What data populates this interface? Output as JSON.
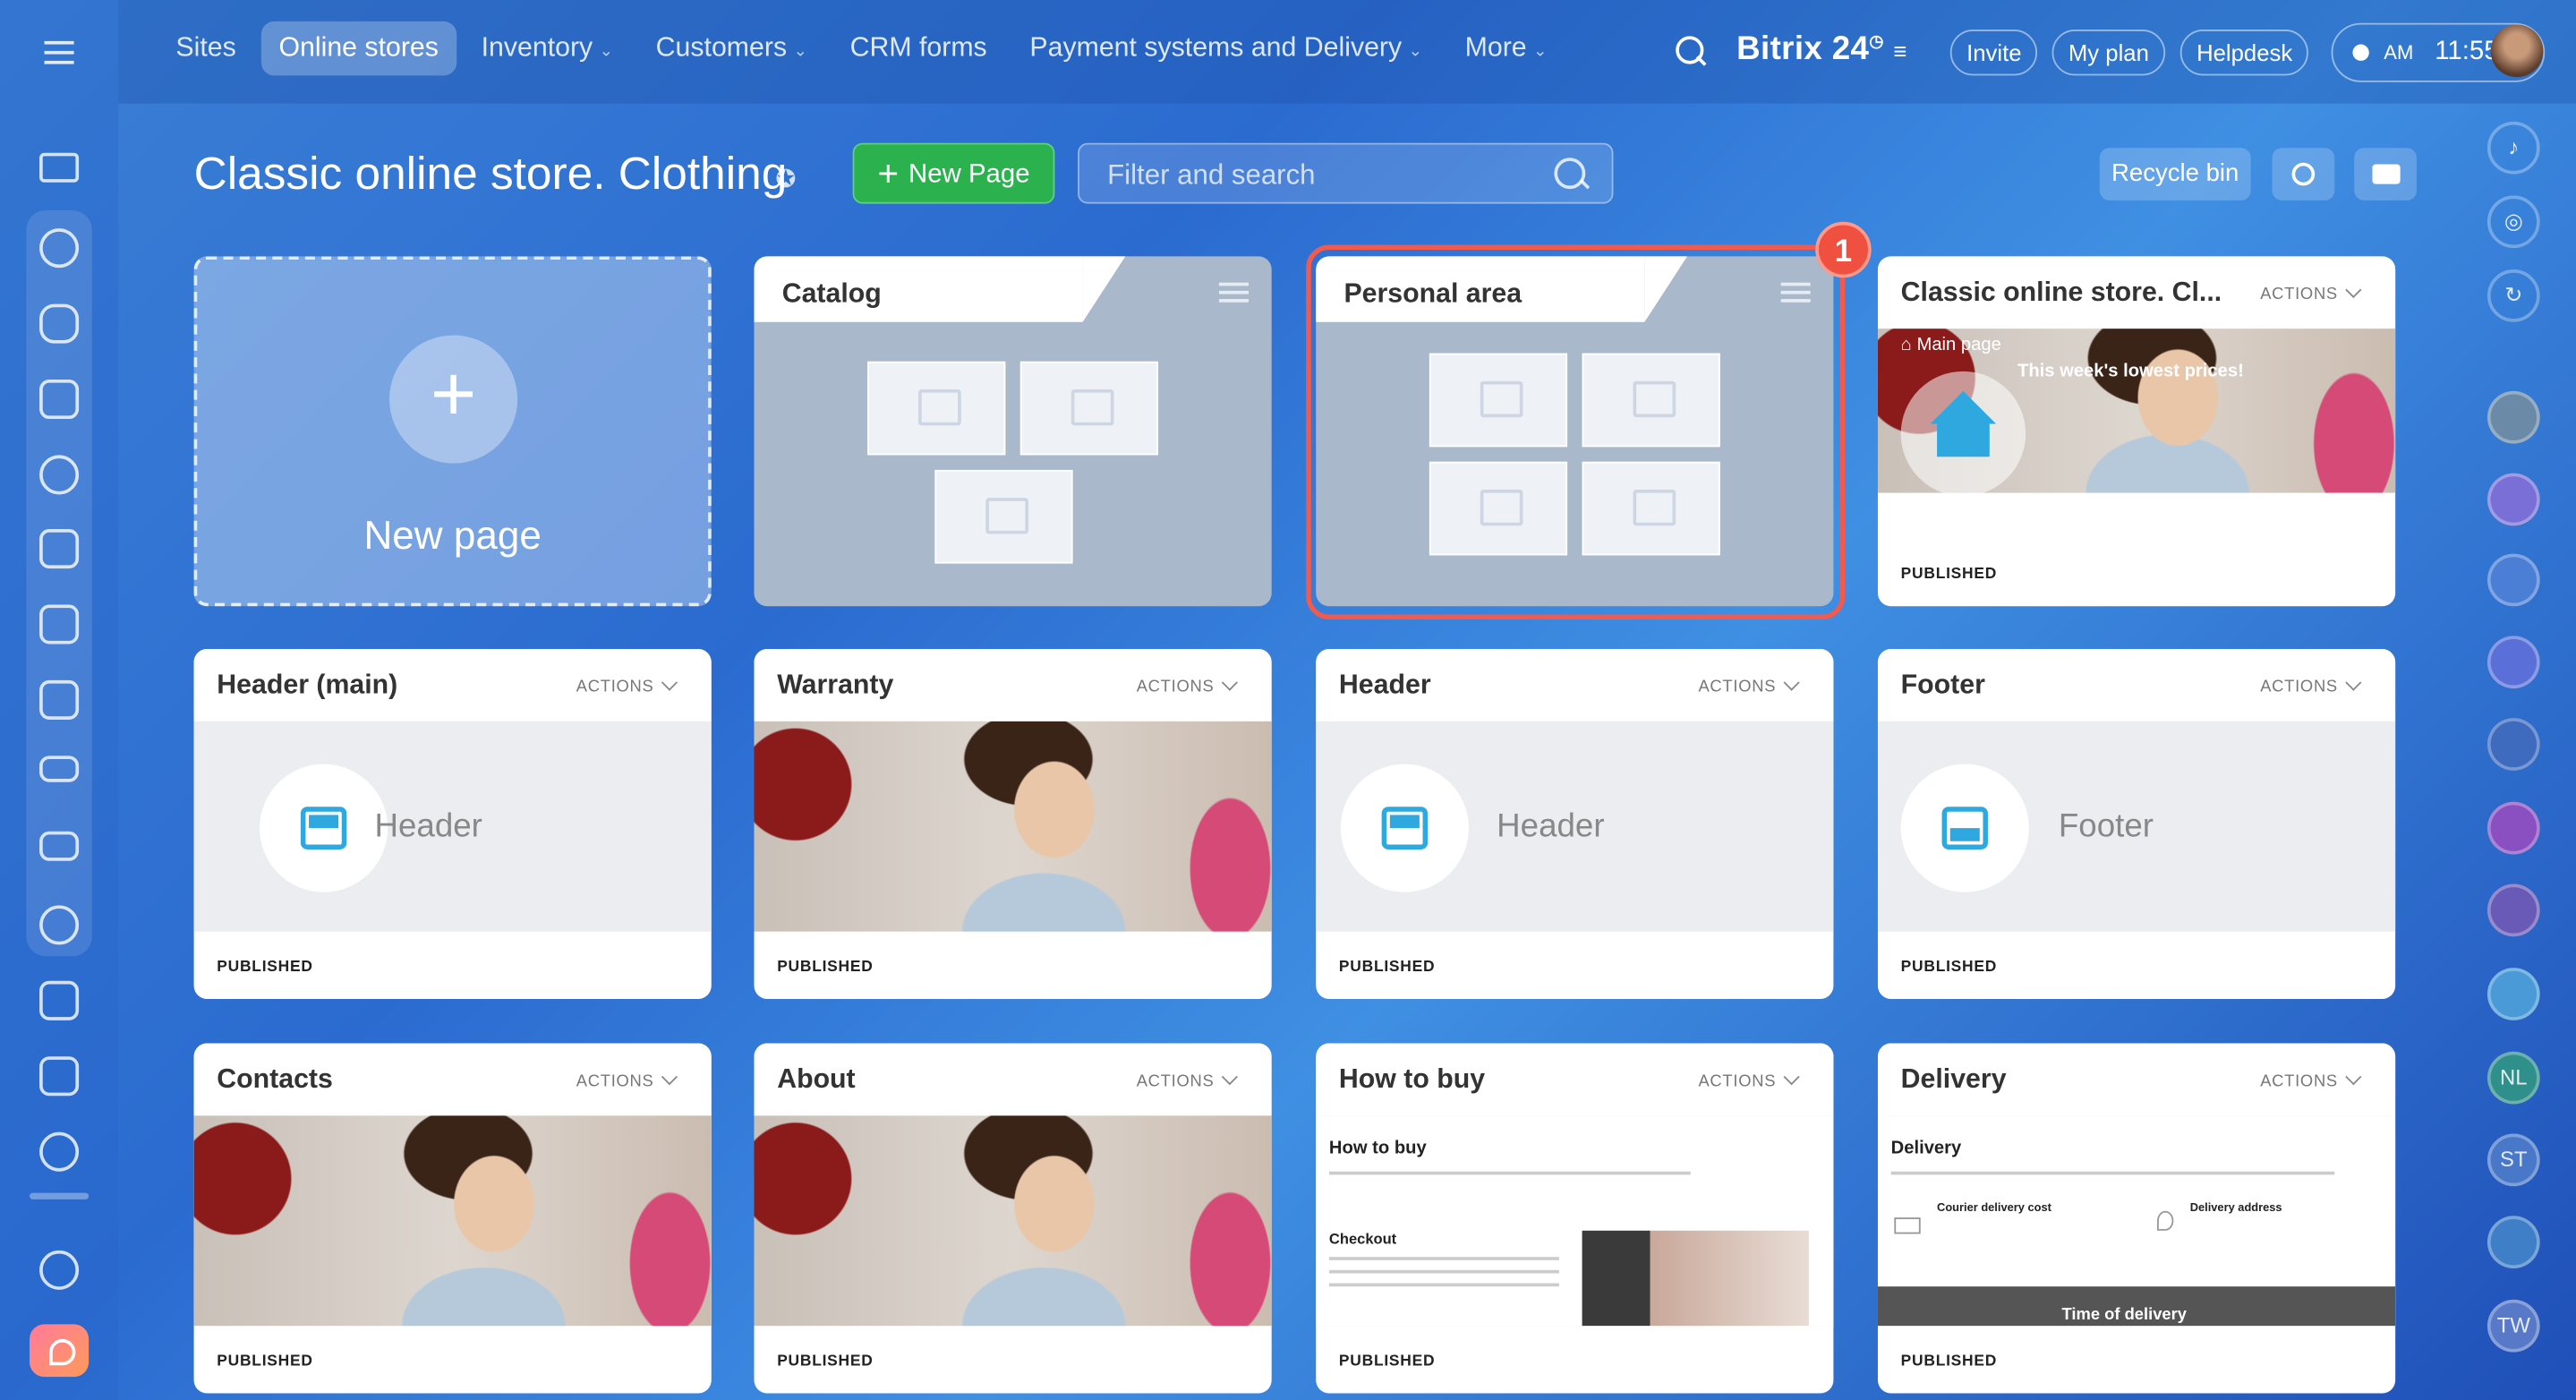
{
  "topnav": {
    "menu_icon": "hamburger-icon",
    "items": [
      {
        "label": "Sites",
        "dropdown": false
      },
      {
        "label": "Online stores",
        "dropdown": false,
        "active": true
      },
      {
        "label": "Inventory",
        "dropdown": true
      },
      {
        "label": "Customers",
        "dropdown": true
      },
      {
        "label": "CRM forms",
        "dropdown": false
      },
      {
        "label": "Payment systems and Delivery",
        "dropdown": true
      },
      {
        "label": "More",
        "dropdown": true
      }
    ],
    "brand": "Bitrix 24",
    "invite": "Invite",
    "my_plan": "My plan",
    "helpdesk": "Helpdesk",
    "time": "11:55",
    "ampm": "AM"
  },
  "page": {
    "title": "Classic online store. Clothing",
    "new_page_button": "New Page",
    "filter_placeholder": "Filter and search",
    "recycle_bin": "Recycle bin"
  },
  "new_page_card": {
    "label": "New page"
  },
  "folders": [
    {
      "title": "Catalog"
    },
    {
      "title": "Personal area",
      "badge": "1"
    }
  ],
  "actions_label": "ACTIONS",
  "published_label": "PUBLISHED",
  "cards": [
    {
      "title": "Classic online store. Cl...",
      "home_label": "Main page",
      "banner": "This week's lowest prices!"
    },
    {
      "title": "Header (main)",
      "placeholder": "Header"
    },
    {
      "title": "Warranty"
    },
    {
      "title": "Header",
      "placeholder": "Header"
    },
    {
      "title": "Footer",
      "placeholder": "Footer"
    },
    {
      "title": "Contacts"
    },
    {
      "title": "About"
    },
    {
      "title": "How to buy",
      "doc_heading": "How to buy",
      "doc_sub": "Checkout"
    },
    {
      "title": "Delivery",
      "doc_heading": "Delivery",
      "col1": "Courier delivery cost",
      "col2": "Delivery address",
      "band": "Time of delivery"
    }
  ],
  "right_sidebar": {
    "initials": [
      "NL",
      "ST",
      "TW"
    ]
  },
  "colors": {
    "accent_green": "#2bb14e",
    "highlight_red": "#f15a4f",
    "header_icon_blue": "#2fa8e0"
  }
}
